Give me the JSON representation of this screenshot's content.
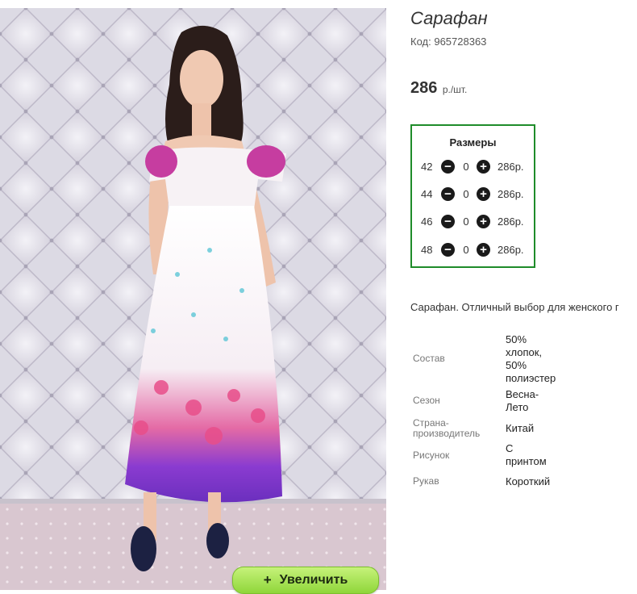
{
  "product": {
    "title": "Сарафан",
    "code_label": "Код:",
    "code_value": "965728363",
    "price": "286",
    "price_unit": "р./шт."
  },
  "sizes": {
    "heading": "Размеры",
    "rows": [
      {
        "size": "42",
        "qty": "0",
        "price": "286р."
      },
      {
        "size": "44",
        "qty": "0",
        "price": "286р."
      },
      {
        "size": "46",
        "qty": "0",
        "price": "286р."
      },
      {
        "size": "48",
        "qty": "0",
        "price": "286р."
      }
    ]
  },
  "description": "Сарафан. Отличный выбор для женского г",
  "attributes": [
    {
      "label": "Состав",
      "value": "50% хлопок, 50% полиэстер"
    },
    {
      "label": "Сезон",
      "value": "Весна-Лето"
    },
    {
      "label": "Страна-производитель",
      "value": "Китай"
    },
    {
      "label": "Рисунок",
      "value": "С принтом"
    },
    {
      "label": "Рукав",
      "value": "Короткий"
    }
  ],
  "gallery": {
    "zoom_label": "Увеличить",
    "zoom_icon": "plus-icon"
  },
  "colors": {
    "frame_green": "#1f8c2a",
    "zoom_button": "#a6e04e"
  }
}
